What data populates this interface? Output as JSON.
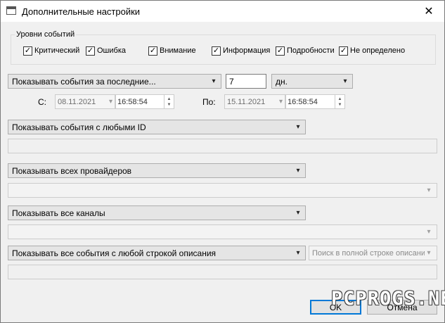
{
  "window": {
    "title": "Дополнительные настройки",
    "close_glyph": "✕"
  },
  "levels": {
    "legend": "Уровни событий",
    "items": [
      {
        "label": "Критический",
        "checked": true
      },
      {
        "label": "Ошибка",
        "checked": true
      },
      {
        "label": "Внимание",
        "checked": true
      },
      {
        "label": "Информация",
        "checked": true
      },
      {
        "label": "Подробности",
        "checked": true
      },
      {
        "label": "Не определено",
        "checked": true
      }
    ]
  },
  "period": {
    "mode": "Показывать события за последние...",
    "count": "7",
    "unit": "дн.",
    "from_label": "С:",
    "from_date": "08.11.2021",
    "from_time": "16:58:54",
    "to_label": "По:",
    "to_date": "15.11.2021",
    "to_time": "16:58:54"
  },
  "filters": {
    "id_mode": "Показывать события с любыми ID",
    "provider_mode": "Показывать всех провайдеров",
    "channel_mode": "Показывать все каналы",
    "description_mode": "Показывать все события с любой строкой описания",
    "search_mode": "Поиск в полной строке описани"
  },
  "buttons": {
    "ok": "OK",
    "cancel": "Отмена"
  },
  "watermark": "PCPROGS.NET",
  "icons": {
    "dropdown": "▾",
    "spin_up": "▲",
    "spin_down": "▼",
    "check": "✓"
  }
}
